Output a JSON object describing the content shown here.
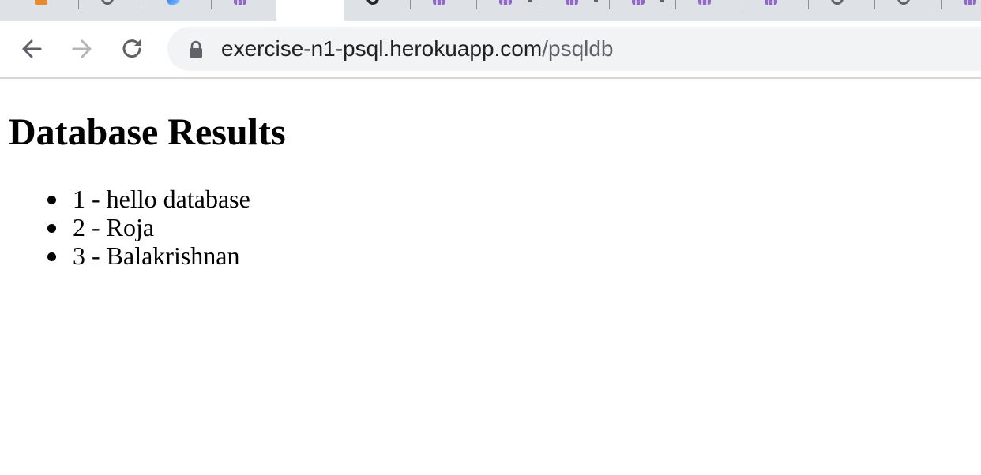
{
  "browser": {
    "tabs": [
      {
        "icon": "orange-favicon-icon"
      },
      {
        "icon": "grey-circle-favicon-icon"
      },
      {
        "icon": "blue-favicon-icon"
      },
      {
        "icon": "purple-heroku-favicon-icon"
      },
      {
        "icon": "active-tab",
        "active": true
      },
      {
        "icon": "github-favicon-icon"
      },
      {
        "icon": "purple-heroku-favicon-icon"
      },
      {
        "icon": "purple-heroku-favicon-icon"
      },
      {
        "icon": "purple-heroku-favicon-icon"
      },
      {
        "icon": "purple-heroku-favicon-icon"
      },
      {
        "icon": "purple-heroku-favicon-icon"
      },
      {
        "icon": "purple-heroku-favicon-icon"
      },
      {
        "icon": "grey-circle-favicon-icon"
      },
      {
        "icon": "grey-circle-favicon-icon"
      },
      {
        "icon": "purple-heroku-favicon-icon"
      }
    ],
    "nav": {
      "back_icon": "back-arrow-icon",
      "forward_icon": "forward-arrow-icon",
      "reload_icon": "reload-icon"
    },
    "address_bar": {
      "lock_icon": "lock-icon",
      "host": "exercise-n1-psql.herokuapp.com",
      "path": "/psqldb"
    }
  },
  "page": {
    "title": "Database Results",
    "results": [
      "1 - hello database",
      "2 - Roja",
      "3 - Balakrishnan"
    ]
  },
  "colors": {
    "tabstrip_bg": "#dee1e6",
    "omnibox_bg": "#f1f3f4",
    "heroku_purple": "#8f6ac2",
    "icon_grey": "#5f6368",
    "text": "#000000"
  }
}
